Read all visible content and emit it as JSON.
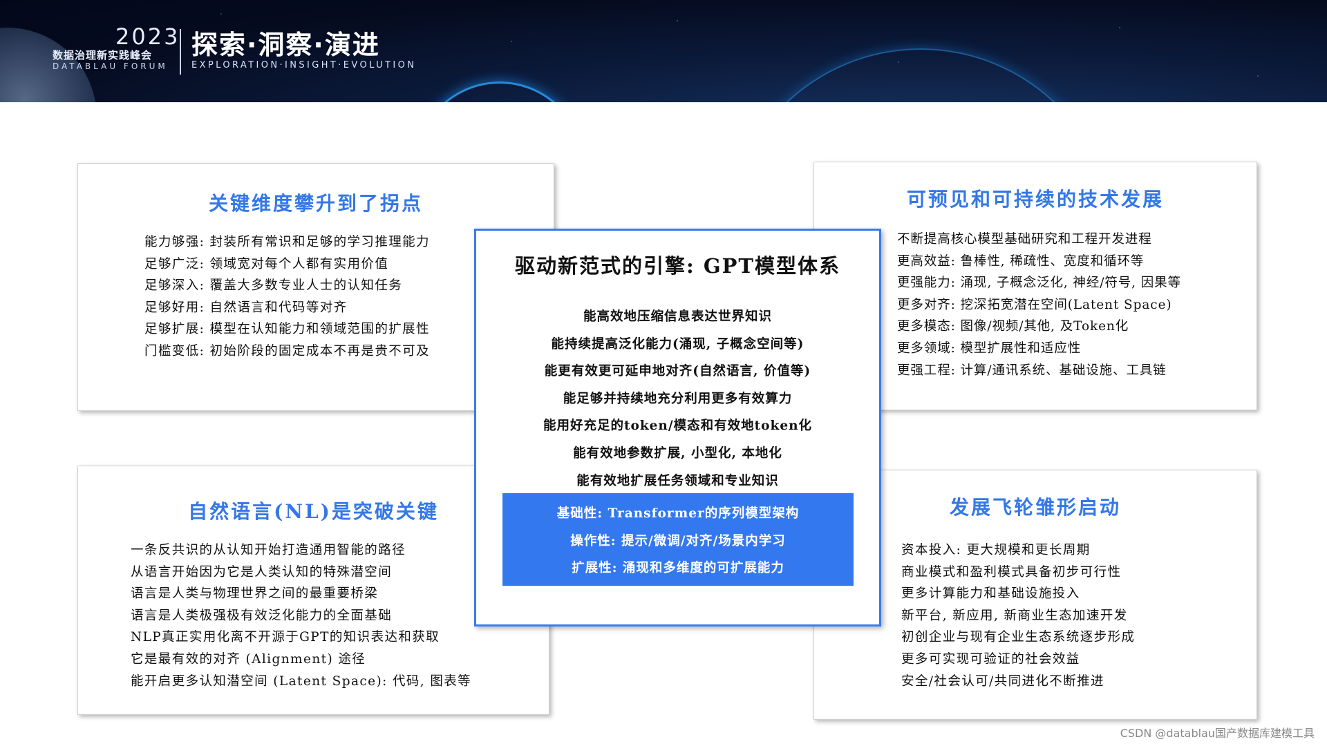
{
  "header": {
    "year": "2023",
    "forum_cn": "数据治理新实践峰会",
    "forum_en": "DATABLAU FORUM",
    "theme_cn": "探索·洞察·演进",
    "theme_en": "EXPLORATION·INSIGHT·EVOLUTION"
  },
  "cards": {
    "top_left": {
      "title": "关键维度攀升到了拐点",
      "items": [
        "能力够强:  封装所有常识和足够的学习推理能力",
        "足够广泛:  领域宽对每个人都有实用价值",
        "足够深入:  覆盖大多数专业人士的认知任务",
        "足够好用:  自然语言和代码等对齐",
        "足够扩展:  模型在认知能力和领域范围的扩展性",
        "门槛变低:  初始阶段的固定成本不再是贵不可及"
      ]
    },
    "top_right": {
      "title": "可预见和可持续的技术发展",
      "items": [
        "不断提高核心模型基础研究和工程开发进程",
        "更高效益:  鲁棒性, 稀疏性、宽度和循环等",
        "更强能力:  涌现, 子概念泛化, 神经/符号, 因果等",
        "更多对齐:  挖深拓宽潜在空间(Latent Space)",
        "更多模态:  图像/视频/其他, 及Token化",
        "更多领域:  模型扩展性和适应性",
        "更强工程:  计算/通讯系统、基础设施、工具链"
      ]
    },
    "bottom_left": {
      "title": "自然语言(NL)是突破关键",
      "items": [
        "一条反共识的从认知开始打造通用智能的路径",
        "从语言开始因为它是人类认知的特殊潜空间",
        "语言是人类与物理世界之间的最重要桥梁",
        "语言是人类极强极有效泛化能力的全面基础",
        "NLP真正实用化离不开源于GPT的知识表达和获取",
        "它是最有效的对齐 (Alignment) 途径",
        "能开启更多认知潜空间 (Latent Space): 代码, 图表等"
      ]
    },
    "bottom_right": {
      "title": "发展飞轮雏形启动",
      "items": [
        "资本投入:  更大规模和更长周期",
        "商业模式和盈利模式具备初步可行性",
        "更多计算能力和基础设施投入",
        "新平台, 新应用, 新商业生态加速开发",
        "初创企业与现有企业生态系统逐步形成",
        "更多可实现可验证的社会效益",
        "安全/社会认可/共同进化不断推进"
      ]
    },
    "center": {
      "title": "驱动新范式的引擎:  GPT模型体系",
      "capabilities": [
        "能高效地压缩信息表达世界知识",
        "能持续提高泛化能力(涌现, 子概念空间等)",
        "能更有效更可延申地对齐(自然语言, 价值等)",
        "能足够并持续地充分利用更多有效算力",
        "能用好充足的token/模态和有效地token化",
        "能有效地参数扩展, 小型化, 本地化",
        "能有效地扩展任务领域和专业知识"
      ],
      "highlights": [
        "基础性:  Transformer的序列模型架构",
        "操作性:  提示/微调/对齐/场景内学习",
        "扩展性:  涌现和多维度的可扩展能力"
      ]
    }
  },
  "watermark": "CSDN @datablau国产数据库建模工具",
  "colors": {
    "accent": "#3478e6",
    "highlight_bg": "#3478f0",
    "banner_bg": "#050b1f"
  }
}
